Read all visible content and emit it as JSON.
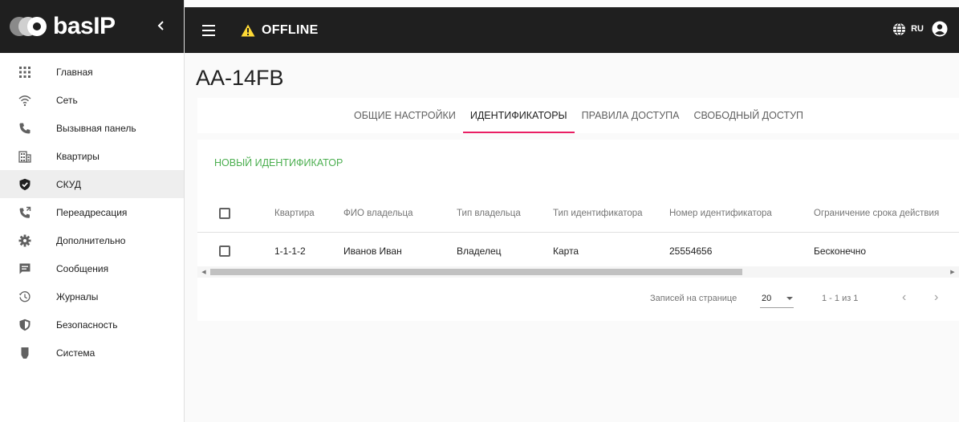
{
  "brand": {
    "name": "basIP"
  },
  "topbar": {
    "status": "OFFLINE",
    "language": "RU",
    "accent_warning": "#fdd835"
  },
  "sidebar": {
    "items": [
      {
        "label": "Главная",
        "icon": "grid-icon"
      },
      {
        "label": "Сеть",
        "icon": "wifi-icon"
      },
      {
        "label": "Вызывная панель",
        "icon": "phone-icon"
      },
      {
        "label": "Квартиры",
        "icon": "building-icon"
      },
      {
        "label": "СКУД",
        "icon": "shield-check-icon"
      },
      {
        "label": "Переадресация",
        "icon": "phone-forward-icon"
      },
      {
        "label": "Дополнительно",
        "icon": "gear-icon"
      },
      {
        "label": "Сообщения",
        "icon": "message-icon"
      },
      {
        "label": "Журналы",
        "icon": "history-icon"
      },
      {
        "label": "Безопасность",
        "icon": "shield-icon"
      },
      {
        "label": "Система",
        "icon": "device-icon"
      }
    ]
  },
  "page": {
    "title": "AA-14FB"
  },
  "tabs": [
    {
      "label": "ОБЩИЕ НАСТРОЙКИ"
    },
    {
      "label": "ИДЕНТИФИКАТОРЫ"
    },
    {
      "label": "ПРАВИЛА ДОСТУПА"
    },
    {
      "label": "СВОБОДНЫЙ ДОСТУП"
    }
  ],
  "accent": "#e91e63",
  "actions": {
    "new_identifier": "НОВЫЙ ИДЕНТИФИКАТОР",
    "color": "#4caf50"
  },
  "table": {
    "headers": [
      "Квартира",
      "ФИО владельца",
      "Тип владельца",
      "Тип идентификатора",
      "Номер идентификатора",
      "Ограничение срока действия"
    ],
    "rows": [
      [
        "1-1-1-2",
        "Иванов Иван",
        "Владелец",
        "Карта",
        "25554656",
        "Бесконечно"
      ]
    ]
  },
  "pager": {
    "rows_label": "Записей на странице",
    "rows_value": "20",
    "range": "1 - 1 из 1"
  }
}
